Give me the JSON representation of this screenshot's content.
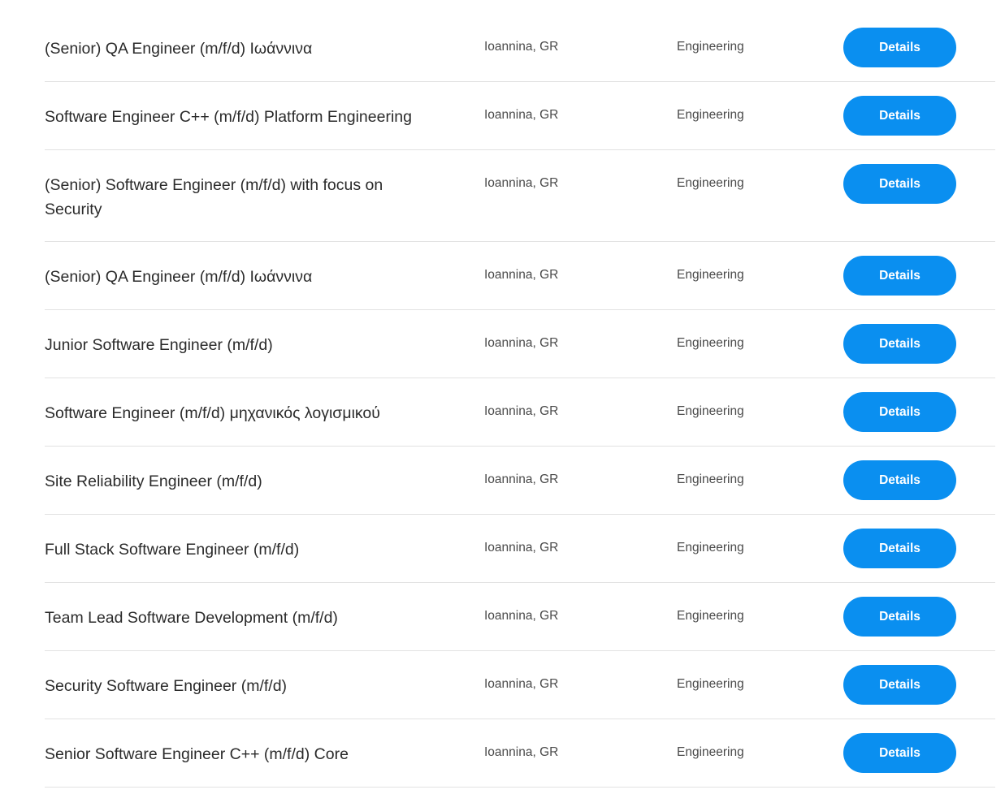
{
  "colors": {
    "accent": "#0a8ff0",
    "divider": "#e2e2e2",
    "text": "#2b2b2b"
  },
  "jobs": [
    {
      "title": "(Senior) QA Engineer (m/f/d) Ιωάννινα",
      "location": "Ioannina, GR",
      "department": "Engineering",
      "button": "Details"
    },
    {
      "title": "Software Engineer C++ (m/f/d) Platform Engineering",
      "location": "Ioannina, GR",
      "department": "Engineering",
      "button": "Details"
    },
    {
      "title": "(Senior) Software Engineer (m/f/d) with focus on Security",
      "location": "Ioannina, GR",
      "department": "Engineering",
      "button": "Details"
    },
    {
      "title": "(Senior) QA Engineer (m/f/d) Ιωάννινα",
      "location": "Ioannina, GR",
      "department": "Engineering",
      "button": "Details"
    },
    {
      "title": "Junior Software Engineer (m/f/d)",
      "location": "Ioannina, GR",
      "department": "Engineering",
      "button": "Details"
    },
    {
      "title": "Software Engineer (m/f/d) μηχανικός λογισμικού",
      "location": "Ioannina, GR",
      "department": "Engineering",
      "button": "Details"
    },
    {
      "title": "Site Reliability Engineer (m/f/d)",
      "location": "Ioannina, GR",
      "department": "Engineering",
      "button": "Details"
    },
    {
      "title": "Full Stack Software Engineer (m/f/d)",
      "location": "Ioannina, GR",
      "department": "Engineering",
      "button": "Details"
    },
    {
      "title": "Team Lead Software Development (m/f/d)",
      "location": "Ioannina, GR",
      "department": "Engineering",
      "button": "Details"
    },
    {
      "title": "Security Software Engineer (m/f/d)",
      "location": "Ioannina, GR",
      "department": "Engineering",
      "button": "Details"
    },
    {
      "title": "Senior Software Engineer C++ (m/f/d) Core",
      "location": "Ioannina, GR",
      "department": "Engineering",
      "button": "Details"
    }
  ]
}
